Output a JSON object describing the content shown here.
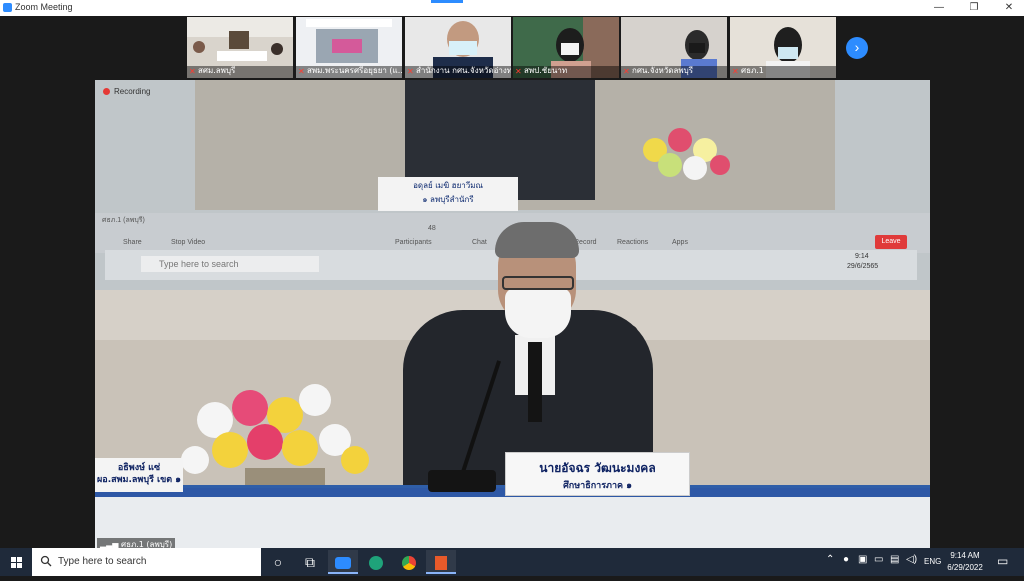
{
  "window": {
    "title": "Zoom Meeting",
    "minimize": "—",
    "maximize": "❐",
    "close": "✕"
  },
  "participants": [
    {
      "name": "สศม.ลพบุรี"
    },
    {
      "name": "สพม.พระนครศรีอยุธยา (แ..."
    },
    {
      "name": "สำนักงาน กศน.จังหวัดอ่างท..."
    },
    {
      "name": "สพป.ชัยนาท"
    },
    {
      "name": "กศน.จังหวัดลพบุรี"
    },
    {
      "name": "ศธภ.1"
    }
  ],
  "main": {
    "recording_label": "Recording",
    "speaker_nameplate": {
      "line1": "นายอัจฉร วัฒนะมงคล",
      "line2": "ศึกษาธิการภาค ๑"
    },
    "left_nameplate": {
      "line1": "อธิพงษ์ แซ่",
      "line2": "ผอ.สพม.ลพบุรี เขต ๑"
    },
    "screen_nameplate": {
      "line1": "อดุลย์ เมฆิ   ฮยาวีมณ",
      "line2": "๑ ลพบุรีสำนักรี"
    },
    "screen_search": "Type here to search",
    "screen_time": "9:14",
    "screen_date": "29/6/2565",
    "screen_toolbar": [
      "Share",
      "Stop Video",
      "Participants",
      "Chat",
      "Record",
      "Reactions",
      "Apps"
    ],
    "screen_participants_count": "48",
    "screen_leave": "Leave",
    "screen_tile_label": "ศธภ.1 (ลพบุรี)",
    "signal_label": "ศธภ.1 (ลพบุรี)"
  },
  "taskbar": {
    "search_placeholder": "Type here to search",
    "language": "ENG",
    "time": "9:14 AM",
    "date": "6/29/2022"
  },
  "colors": {
    "accent": "#2d8cff",
    "taskbar": "#1f2a3a",
    "record_red": "#e53935"
  }
}
